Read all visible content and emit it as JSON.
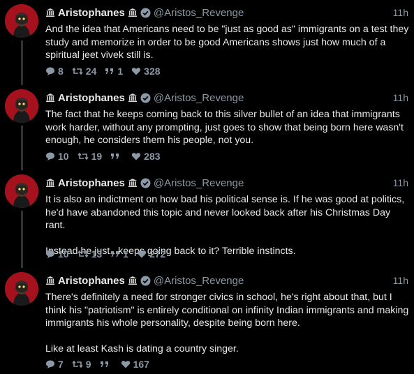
{
  "author": {
    "name": "Aristophanes",
    "handle": "@Aristos_Revenge",
    "verified": true
  },
  "colors": {
    "background": "#000000",
    "text": "#e7e9ea",
    "muted": "#8b98a5",
    "avatar_red": "#a5121e",
    "verified_badge": "#8b98a5"
  },
  "tweets": [
    {
      "time": "11h",
      "text": "And the idea that Americans need to be \"just as good as\" immigrants on a test they study and memorize in order to be good Americans shows just how much of a spiritual jeet vivek still is.",
      "replies": "8",
      "retweets": "24",
      "quotes": "1",
      "likes": "328"
    },
    {
      "time": "11h",
      "text": "The fact that he keeps coming back to this silver bullet of an idea that immigrants work harder, without any prompting, just goes to show that being born here wasn't enough, he considers them his people, not you.",
      "replies": "10",
      "retweets": "19",
      "quotes": "",
      "likes": "283"
    },
    {
      "time": "11h",
      "text": "It is also an indictment on how bad his political sense is. If he was good at politics, he'd have abandoned this topic and never looked back after his Christmas Day rant.\n\nInstead he just.. keeps going back to it? Terrible instincts.",
      "replies": "10",
      "retweets": "13",
      "quotes": "1",
      "likes": "272"
    },
    {
      "time": "11h",
      "text": "There's definitely a need for stronger civics in school, he's right about that, but I think his \"patriotism\" is entirely conditional on infinity Indian immigrants and making immigrants his whole personality, despite being born here.\n\nLike at least Kash is dating a country singer.",
      "replies": "7",
      "retweets": "9",
      "quotes": "",
      "likes": "167"
    }
  ],
  "icons": {
    "reply": "speech-bubble-icon",
    "retweet": "retweet-icon",
    "quote": "quote-icon",
    "like": "heart-icon",
    "name_decoration": "classical-building-icon",
    "verified": "verified-check-icon"
  }
}
